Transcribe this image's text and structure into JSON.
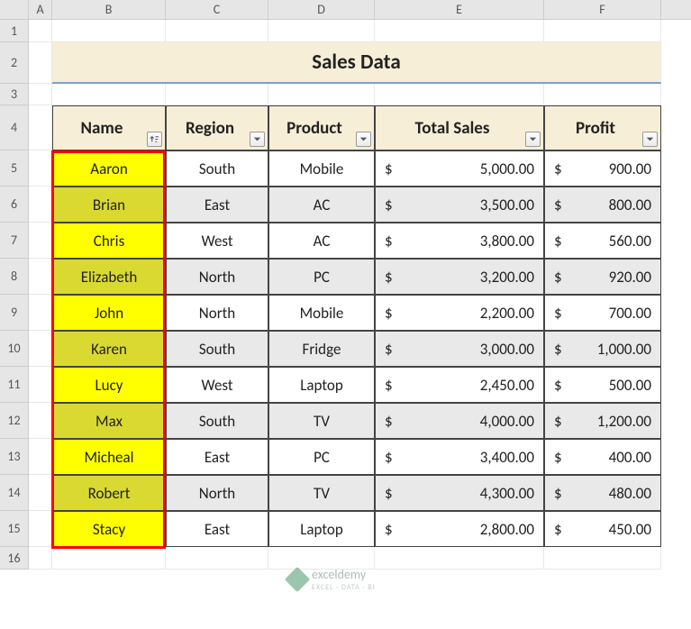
{
  "columns": [
    "A",
    "B",
    "C",
    "D",
    "E",
    "F"
  ],
  "rows": [
    "1",
    "2",
    "3",
    "4",
    "5",
    "6",
    "7",
    "8",
    "9",
    "10",
    "11",
    "12",
    "13",
    "14",
    "15",
    "16"
  ],
  "title": "Sales Data",
  "headers": {
    "name": "Name",
    "region": "Region",
    "product": "Product",
    "total_sales": "Total Sales",
    "profit": "Profit"
  },
  "currency_symbol": "$",
  "data": [
    {
      "name": "Aaron",
      "region": "South",
      "product": "Mobile",
      "total_sales": "5,000.00",
      "profit": "900.00"
    },
    {
      "name": "Brian",
      "region": "East",
      "product": "AC",
      "total_sales": "3,500.00",
      "profit": "800.00"
    },
    {
      "name": "Chris",
      "region": "West",
      "product": "AC",
      "total_sales": "3,800.00",
      "profit": "560.00"
    },
    {
      "name": "Elizabeth",
      "region": "North",
      "product": "PC",
      "total_sales": "3,200.00",
      "profit": "920.00"
    },
    {
      "name": "John",
      "region": "North",
      "product": "Mobile",
      "total_sales": "2,200.00",
      "profit": "700.00"
    },
    {
      "name": "Karen",
      "region": "South",
      "product": "Fridge",
      "total_sales": "3,000.00",
      "profit": "1,000.00"
    },
    {
      "name": "Lucy",
      "region": "West",
      "product": "Laptop",
      "total_sales": "2,450.00",
      "profit": "500.00"
    },
    {
      "name": "Max",
      "region": "South",
      "product": "TV",
      "total_sales": "4,000.00",
      "profit": "1,200.00"
    },
    {
      "name": "Micheal",
      "region": "East",
      "product": "PC",
      "total_sales": "3,400.00",
      "profit": "400.00"
    },
    {
      "name": "Robert",
      "region": "North",
      "product": "TV",
      "total_sales": "4,300.00",
      "profit": "480.00"
    },
    {
      "name": "Stacy",
      "region": "East",
      "product": "Laptop",
      "total_sales": "2,800.00",
      "profit": "450.00"
    }
  ],
  "watermark": {
    "brand": "exceldemy",
    "tagline": "EXCEL · DATA · BI"
  },
  "chart_data": {
    "type": "table",
    "title": "Sales Data",
    "columns": [
      "Name",
      "Region",
      "Product",
      "Total Sales",
      "Profit"
    ],
    "rows": [
      [
        "Aaron",
        "South",
        "Mobile",
        5000.0,
        900.0
      ],
      [
        "Brian",
        "East",
        "AC",
        3500.0,
        800.0
      ],
      [
        "Chris",
        "West",
        "AC",
        3800.0,
        560.0
      ],
      [
        "Elizabeth",
        "North",
        "PC",
        3200.0,
        920.0
      ],
      [
        "John",
        "North",
        "Mobile",
        2200.0,
        700.0
      ],
      [
        "Karen",
        "South",
        "Fridge",
        3000.0,
        1000.0
      ],
      [
        "Lucy",
        "West",
        "Laptop",
        2450.0,
        500.0
      ],
      [
        "Max",
        "South",
        "TV",
        4000.0,
        1200.0
      ],
      [
        "Micheal",
        "East",
        "PC",
        3400.0,
        400.0
      ],
      [
        "Robert",
        "North",
        "TV",
        4300.0,
        480.0
      ],
      [
        "Stacy",
        "East",
        "Laptop",
        2800.0,
        450.0
      ]
    ]
  }
}
